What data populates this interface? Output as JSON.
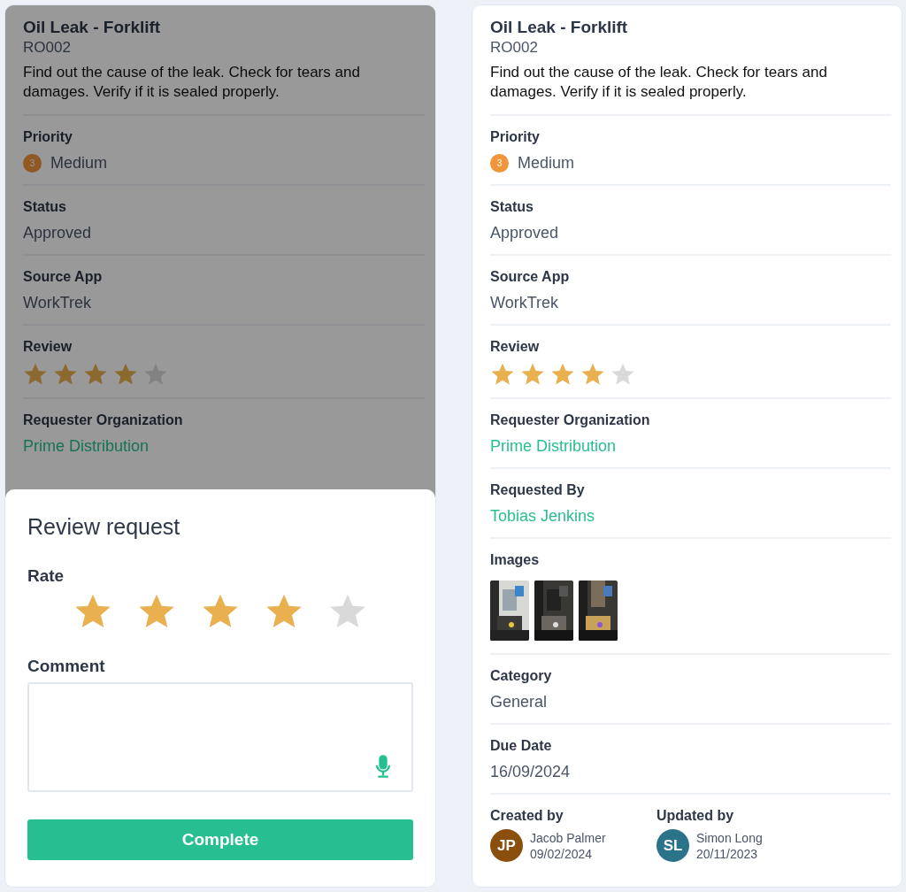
{
  "panels": [
    {
      "card": {
        "title": "Oil Leak - Forklift",
        "id": "RO002",
        "description": "Find out the cause of the leak. Check for tears and damages. Verify if it is sealed properly.",
        "fields": [
          {
            "kind": "priority",
            "label": "Priority",
            "badge": "3",
            "value": "Medium",
            "color": "#905923"
          },
          {
            "kind": "text",
            "label": "Status",
            "value": "Approved"
          },
          {
            "kind": "text",
            "label": "Source App",
            "value": "WorkTrek"
          },
          {
            "kind": "stars",
            "label": "Review",
            "stars": 4
          },
          {
            "kind": "link",
            "label": "Requester Organization",
            "value": "Prime Distribution"
          }
        ]
      },
      "sheet": {
        "title": "Review request",
        "rate_label": "Rate",
        "stars": 4,
        "comment_label": "Comment",
        "button": "Complete"
      }
    },
    {
      "card": {
        "title": "Oil Leak - Forklift",
        "id": "RO002",
        "description": "Find out the cause of the leak. Check for tears and damages. Verify if it is sealed properly.",
        "fields": [
          {
            "kind": "priority",
            "label": "Priority",
            "badge": "3",
            "value": "Medium",
            "color": "#f0953a"
          },
          {
            "kind": "text",
            "label": "Status",
            "value": "Approved"
          },
          {
            "kind": "text",
            "label": "Source App",
            "value": "WorkTrek"
          },
          {
            "kind": "stars",
            "label": "Review",
            "stars": 4
          },
          {
            "kind": "link",
            "label": "Requester Organization",
            "value": "Prime Distribution"
          },
          {
            "kind": "link",
            "label": "Requested By",
            "value": "Tobias Jenkins"
          },
          {
            "kind": "images",
            "label": "Images"
          },
          {
            "kind": "text",
            "label": "Category",
            "value": "General"
          },
          {
            "kind": "text",
            "label": "Due Date",
            "value": "16/09/2024"
          },
          {
            "kind": "people",
            "people": [
              {
                "label": "Created by",
                "initials": "JP",
                "name": "Jacob Palmer",
                "date": "09/02/2024",
                "color": "#8a4f0c"
              },
              {
                "label": "Updated by",
                "initials": "SL",
                "name": "Simon Long",
                "date": "20/11/2023",
                "color": "#2a7389"
              }
            ]
          }
        ]
      }
    }
  ]
}
